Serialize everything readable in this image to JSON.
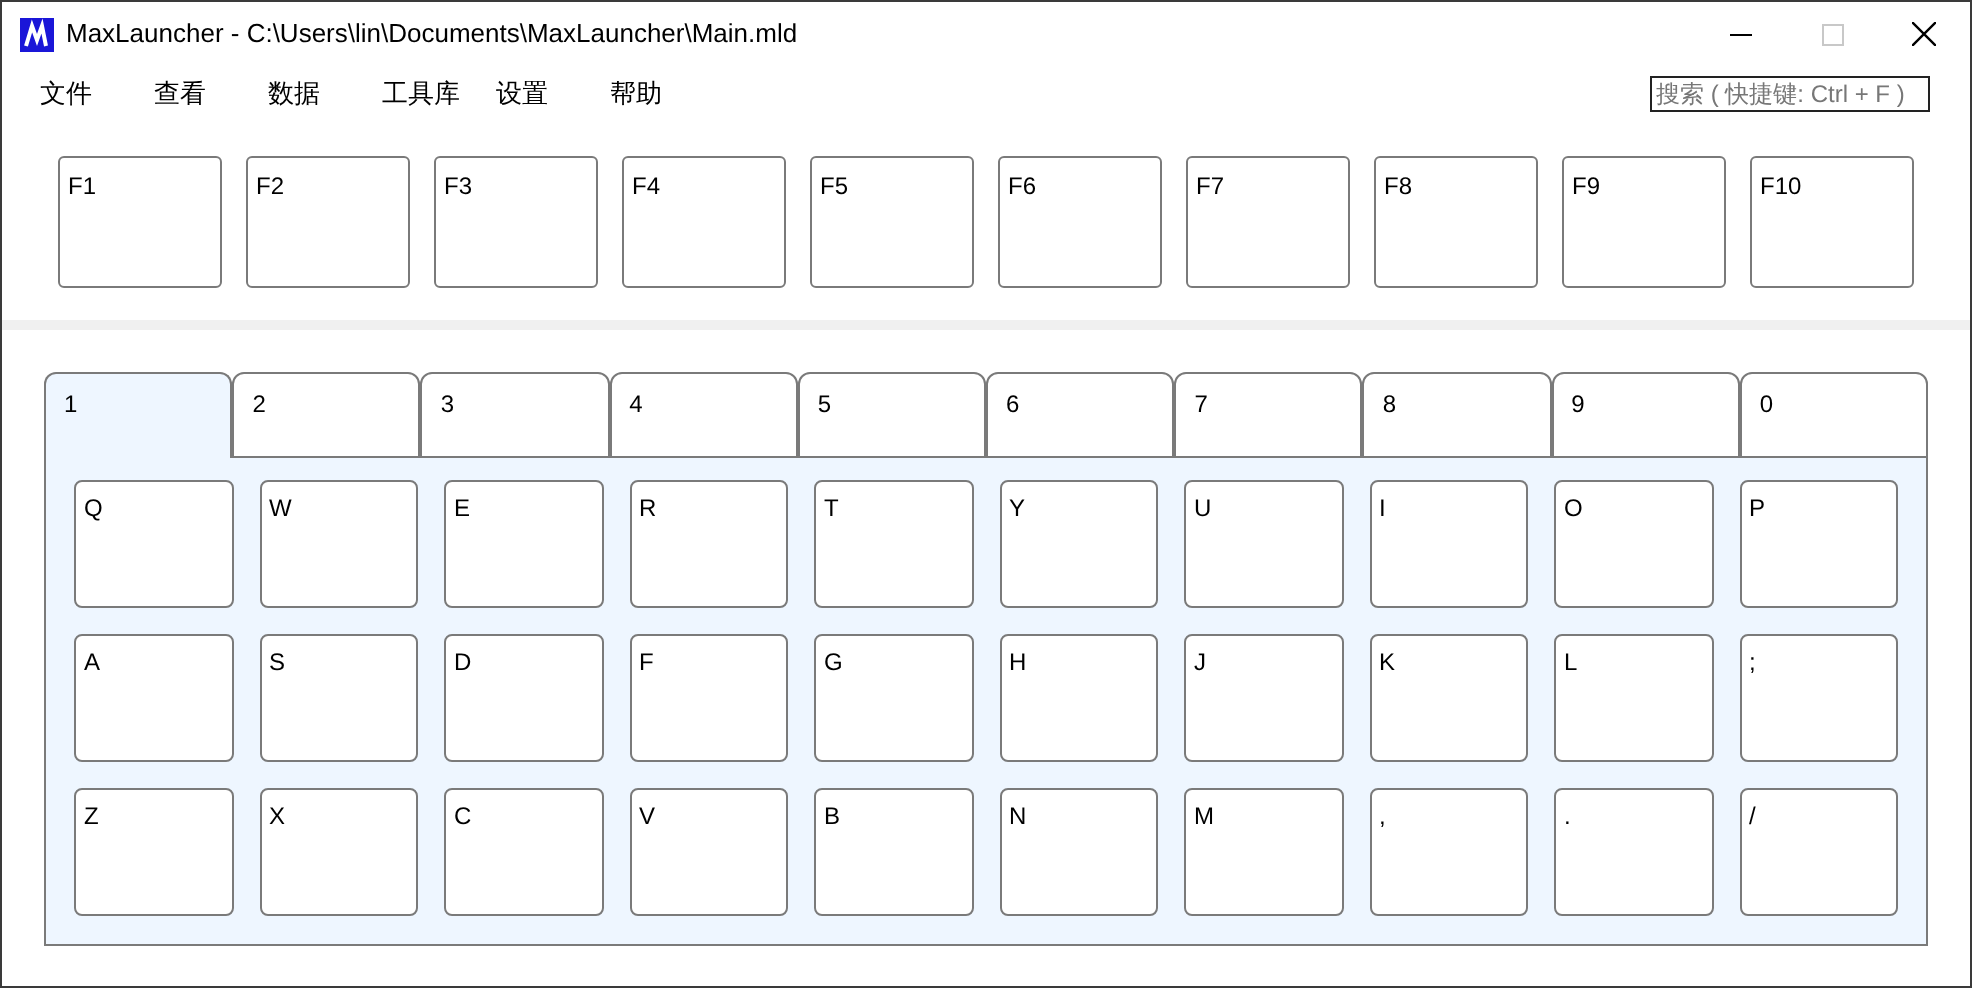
{
  "window": {
    "title": "MaxLauncher - C:\\Users\\lin\\Documents\\MaxLauncher\\Main.mld"
  },
  "menu": [
    "文件",
    "查看",
    "数据",
    "工具库",
    "设置",
    "帮助"
  ],
  "search": {
    "placeholder": "搜索 ( 快捷键: Ctrl + F )"
  },
  "function_keys": [
    "F1",
    "F2",
    "F3",
    "F4",
    "F5",
    "F6",
    "F7",
    "F8",
    "F9",
    "F10"
  ],
  "tabs": [
    {
      "label": "1",
      "selected": true
    },
    {
      "label": "2",
      "selected": false
    },
    {
      "label": "3",
      "selected": false
    },
    {
      "label": "4",
      "selected": false
    },
    {
      "label": "5",
      "selected": false
    },
    {
      "label": "6",
      "selected": false
    },
    {
      "label": "7",
      "selected": false
    },
    {
      "label": "8",
      "selected": false
    },
    {
      "label": "9",
      "selected": false
    },
    {
      "label": "0",
      "selected": false
    }
  ],
  "key_rows": [
    [
      "Q",
      "W",
      "E",
      "R",
      "T",
      "Y",
      "U",
      "I",
      "O",
      "P"
    ],
    [
      "A",
      "S",
      "D",
      "F",
      "G",
      "H",
      "J",
      "K",
      "L",
      ";"
    ],
    [
      "Z",
      "X",
      "C",
      "V",
      "B",
      "N",
      "M",
      ",",
      ".",
      "/"
    ]
  ]
}
